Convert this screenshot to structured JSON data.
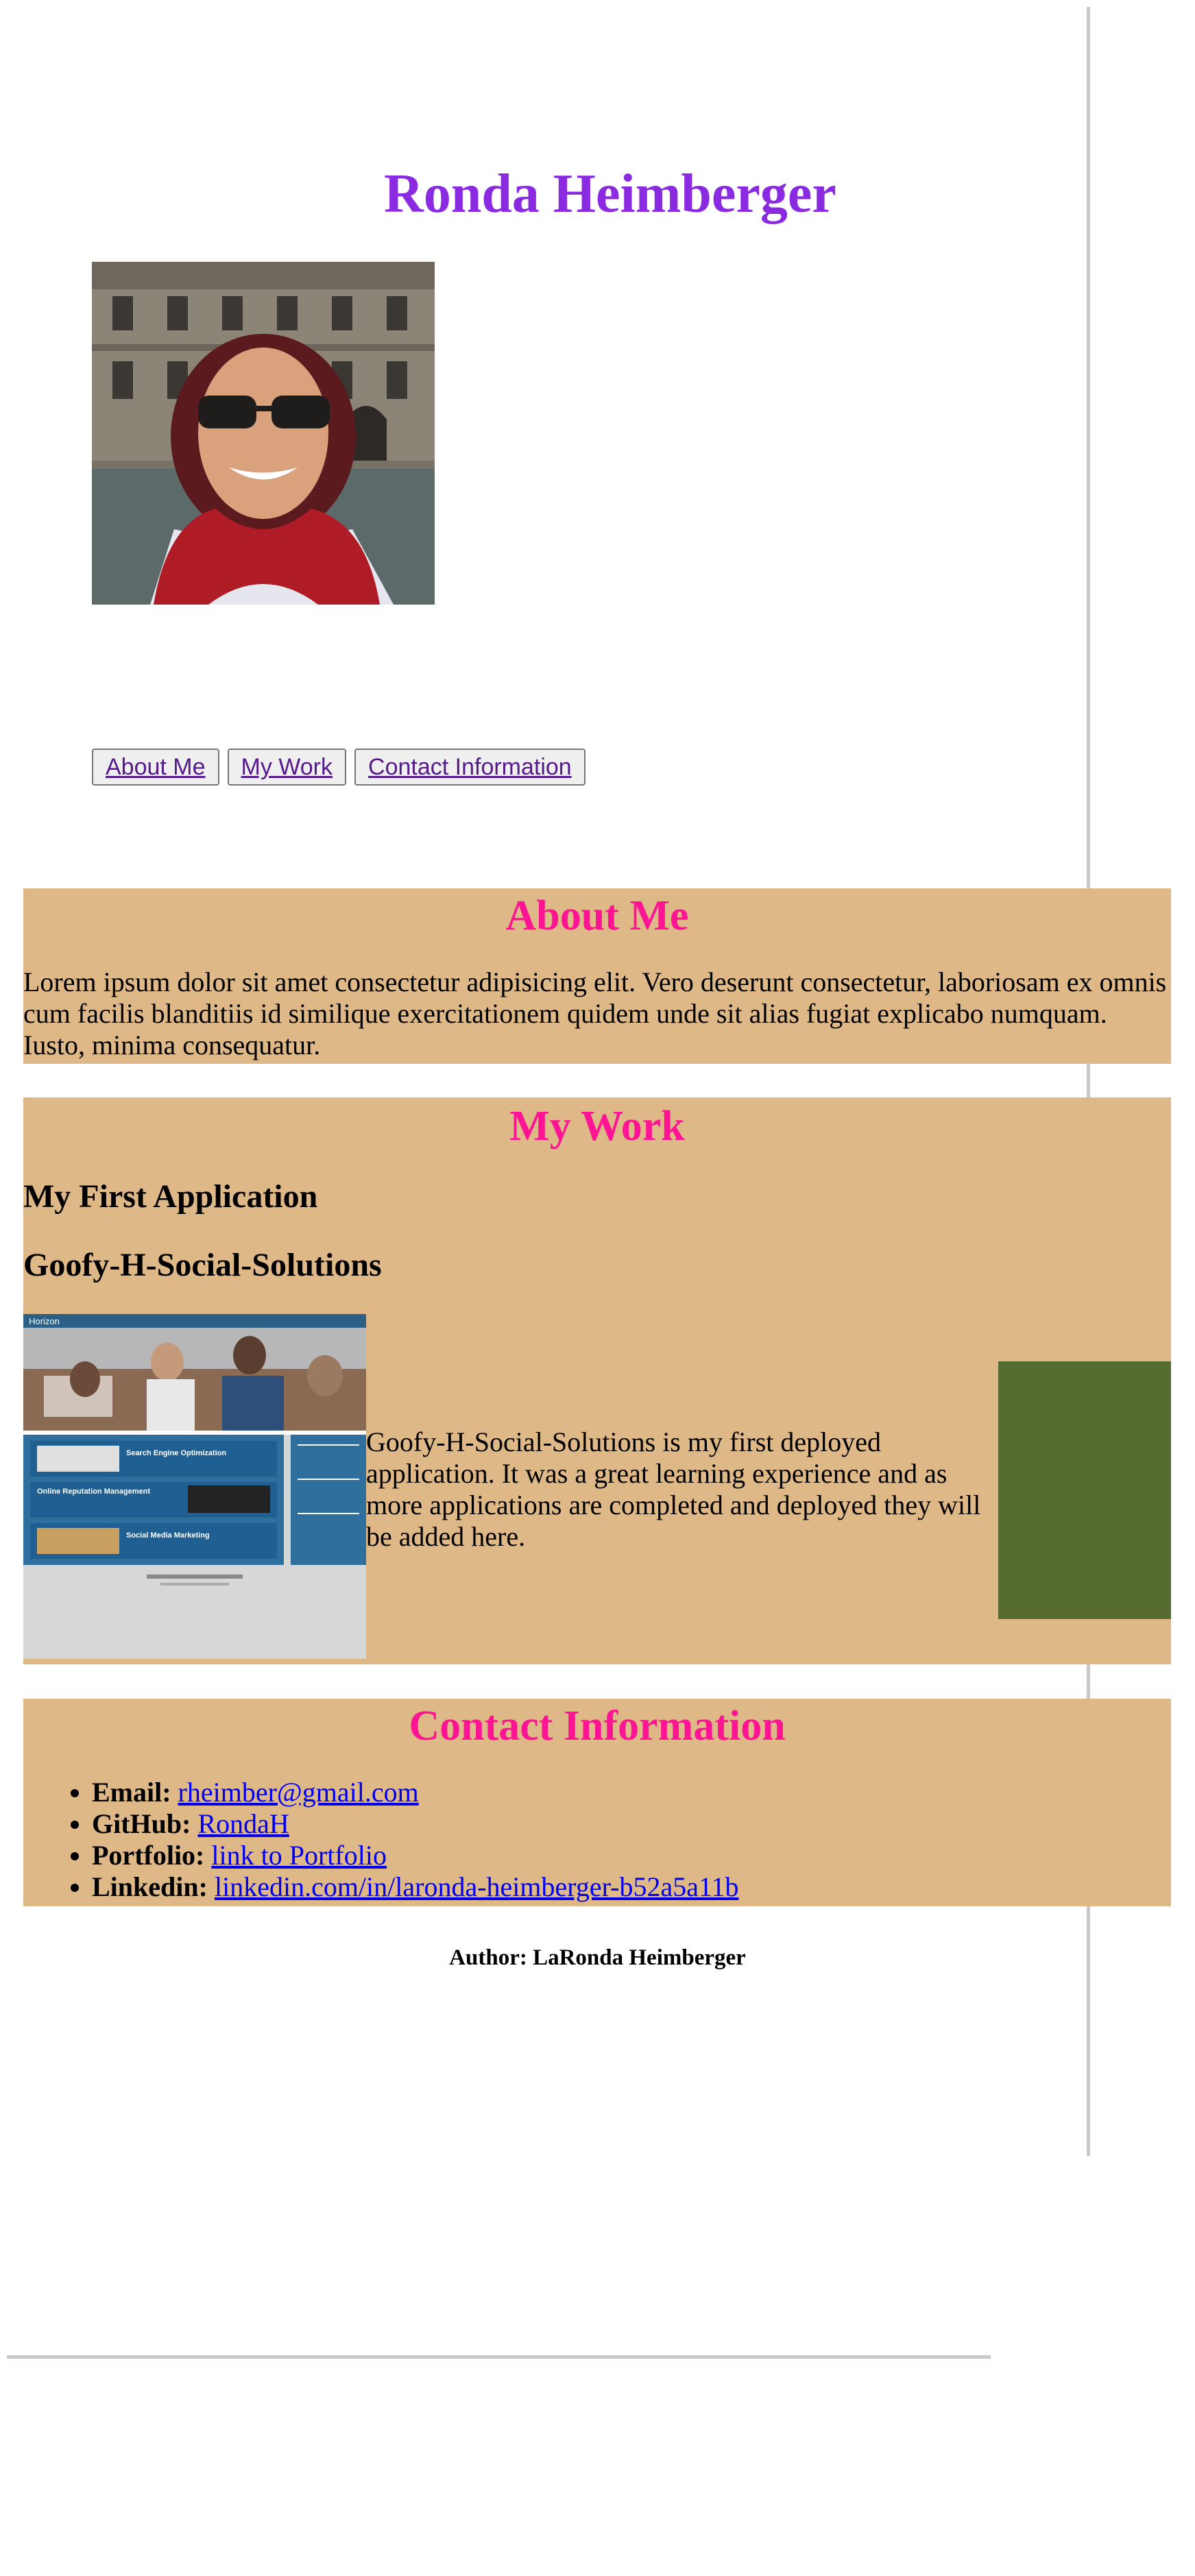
{
  "header": {
    "title": "Ronda Heimberger",
    "portrait_icon": "portrait-photo"
  },
  "nav": {
    "items": [
      {
        "label": "About Me"
      },
      {
        "label": "My Work"
      },
      {
        "label": "Contact Information"
      }
    ]
  },
  "about": {
    "title": "About Me",
    "text": "Lorem ipsum dolor sit amet consectetur adipisicing elit. Vero deserunt consectetur, laboriosam ex omnis cum facilis blanditiis id similique exercitationem quidem unde sit alias fugiat explicabo numquam. Iusto, minima consequatur."
  },
  "work": {
    "title": "My Work",
    "heading1": "My First Application",
    "heading2": "Goofy-H-Social-Solutions",
    "screenshot": {
      "brand": "Horizon",
      "tiles": [
        "Search Engine Optimization",
        "Online Reputation Management",
        "Social Media Marketing"
      ]
    },
    "description": "Goofy-H-Social-Solutions is my first deployed application. It was a great learning experience and as more applications are completed and deployed they will be added here."
  },
  "contact": {
    "title": "Contact Information",
    "items": [
      {
        "label": "Email:",
        "value": "rheimber@gmail.com"
      },
      {
        "label": "GitHub:",
        "value": "RondaH"
      },
      {
        "label": "Portfolio:",
        "value": "link to Portfolio"
      },
      {
        "label": "Linkedin:",
        "value": "linkedin.com/in/laronda-heimberger-b52a5a11b"
      }
    ]
  },
  "footer": {
    "author": "Author: LaRonda Heimberger"
  },
  "colors": {
    "title": "#8a2be2",
    "section_bg": "#deb887",
    "section_title": "#ff1493",
    "accent_box": "#556b2f",
    "link": "#0000ee"
  }
}
